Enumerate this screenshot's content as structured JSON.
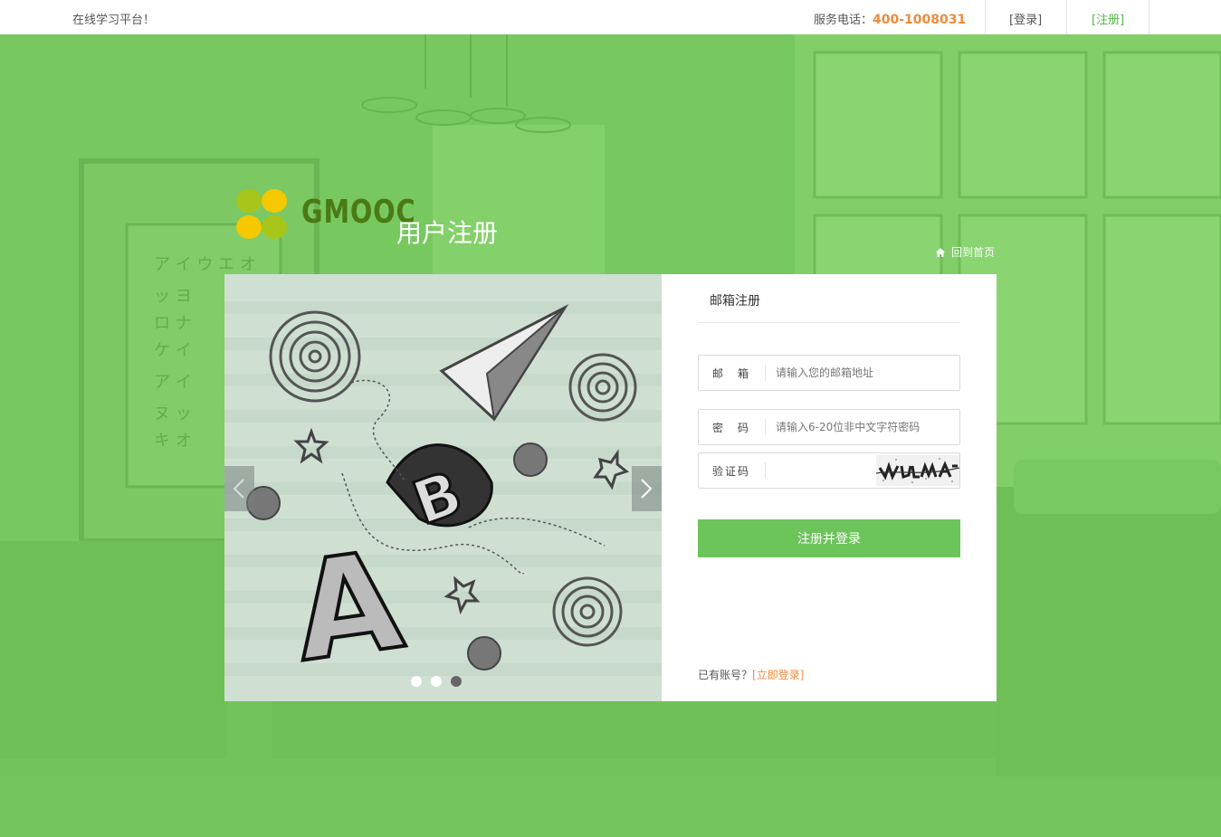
{
  "topbar": {
    "slogan": "在线学习平台！",
    "phone_label": "服务电话：",
    "phone_number": "400-1008031",
    "login_link": "[登录]",
    "register_link": "[注册]"
  },
  "brand": {
    "name": "GMOOC",
    "page_title": "用户注册",
    "home_link": "回到首页"
  },
  "slider": {
    "dots": 3,
    "active_dot": 3
  },
  "form": {
    "tab": "邮箱注册",
    "email_label": "邮　箱",
    "email_placeholder": "请输入您的邮箱地址",
    "password_label": "密　码",
    "password_placeholder": "请输入6-20位非中文字符密码",
    "captcha_label": "验证码",
    "captcha_value": "",
    "submit_label": "注册并登录",
    "has_account_text": "已有账号？",
    "login_now_link": "[立即登录]"
  },
  "colors": {
    "background": "#78c860",
    "accent": "#6cc55a",
    "phone": "#f08a3c",
    "brand": "#4a7a14"
  }
}
